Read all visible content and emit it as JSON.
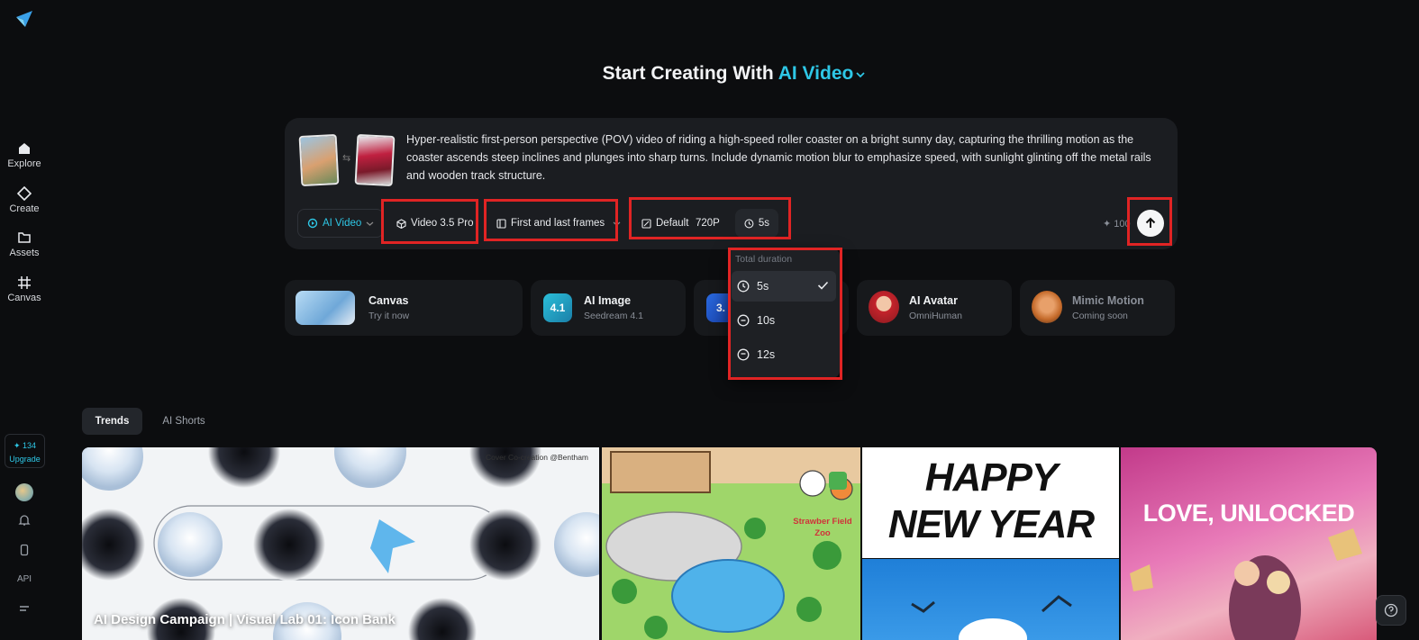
{
  "sidebar": {
    "items": [
      {
        "label": "Explore",
        "icon": "home-icon"
      },
      {
        "label": "Create",
        "icon": "diamond-icon"
      },
      {
        "label": "Assets",
        "icon": "folder-icon"
      },
      {
        "label": "Canvas",
        "icon": "grid-icon"
      }
    ],
    "credits": {
      "amount": "✦ 134",
      "upgrade_label": "Upgrade"
    },
    "api_label": "API"
  },
  "header": {
    "title_prefix": "Start Creating With",
    "title_accent": "AI Video"
  },
  "prompt": {
    "text": "Hyper-realistic first-person perspective (POV) video of riding a high-speed roller coaster on a bright sunny day, capturing the thrilling motion as the coaster ascends steep inclines and plunges into sharp turns. Include dynamic motion blur to emphasize speed, with sunlight glinting off the metal rails and wooden track structure."
  },
  "controls": {
    "mode_label": "AI Video",
    "model_label": "Video 3.5 Pro",
    "frames_label": "First and last frames",
    "ratio_label": "Default",
    "resolution_label": "720P",
    "duration_label": "5s",
    "cost_label": "✦ 100"
  },
  "duration_menu": {
    "header": "Total duration",
    "options": [
      "5s",
      "10s",
      "12s"
    ],
    "selected": "5s"
  },
  "tools": [
    {
      "title": "Canvas",
      "subtitle": "Try it now"
    },
    {
      "title": "AI Image",
      "subtitle": "Seedream 4.1",
      "badge": "4.1"
    },
    {
      "title": "",
      "subtitle": "",
      "badge": "3."
    },
    {
      "title": "AI Avatar",
      "subtitle": "OmniHuman"
    },
    {
      "title": "Mimic Motion",
      "subtitle": "Coming soon"
    }
  ],
  "tabs": [
    {
      "label": "Trends",
      "active": true
    },
    {
      "label": "AI Shorts",
      "active": false
    }
  ],
  "gallery": [
    {
      "caption": "AI Design Campaign | Visual Lab 01: Icon Bank",
      "credit": "Cover Co-creation @Bentham"
    },
    {
      "caption": "",
      "overlay_text": "Strawber Field Zoo"
    },
    {
      "caption": "",
      "overlay_text": "HAPPY NEW YEAR"
    },
    {
      "caption": "",
      "overlay_text": "LOVE, UNLOCKED"
    }
  ],
  "colors": {
    "accent": "#2ec7e6",
    "highlight": "#e02424",
    "background": "#0c0d0f"
  }
}
